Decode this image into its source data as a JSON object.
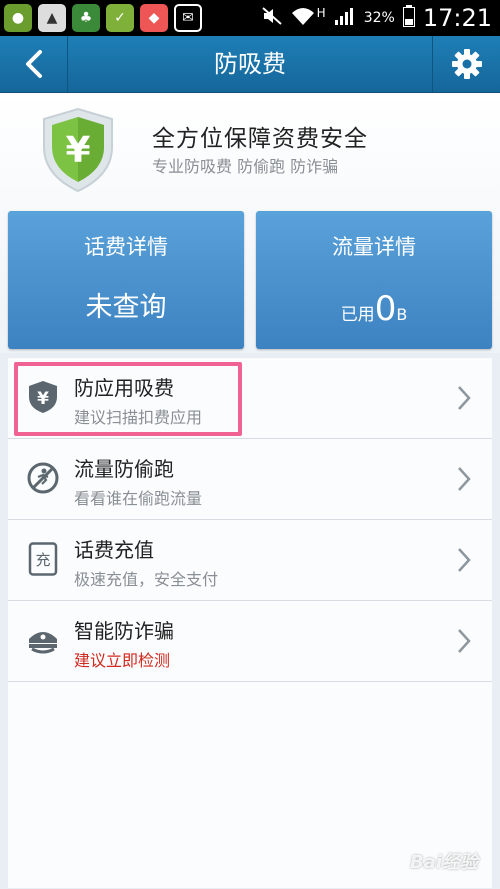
{
  "status_bar": {
    "signal_type": "H",
    "battery": "32%",
    "time": "17:21"
  },
  "title_bar": {
    "title": "防吸费"
  },
  "header": {
    "title": "全方位保障资费安全",
    "subtitle": "专业防吸费 防偷跑 防诈骗",
    "shield_glyph": "¥"
  },
  "cards": {
    "fee": {
      "title": "话费详情",
      "value": "未查询"
    },
    "data": {
      "title": "流量详情",
      "prefix": "已用",
      "number": "0",
      "unit": "B"
    }
  },
  "list": {
    "items": [
      {
        "title": "防应用吸费",
        "subtitle": "建议扫描扣费应用",
        "icon": "shield-yen-icon",
        "icon_glyph": "¥"
      },
      {
        "title": "流量防偷跑",
        "subtitle": "看看谁在偷跑流量",
        "icon": "no-run-icon"
      },
      {
        "title": "话费充值",
        "subtitle": "极速充值，安全支付",
        "icon": "recharge-icon",
        "icon_glyph": "充"
      },
      {
        "title": "智能防诈骗",
        "subtitle": "建议立即检测",
        "icon": "police-cap-icon"
      }
    ]
  },
  "watermark": "Bai经验",
  "colors": {
    "titlebar": "#1e7fb6",
    "card": "#4a90ce",
    "shield_green": "#7cc243",
    "highlight": "#f06292",
    "warning_text": "#d12a1f"
  }
}
